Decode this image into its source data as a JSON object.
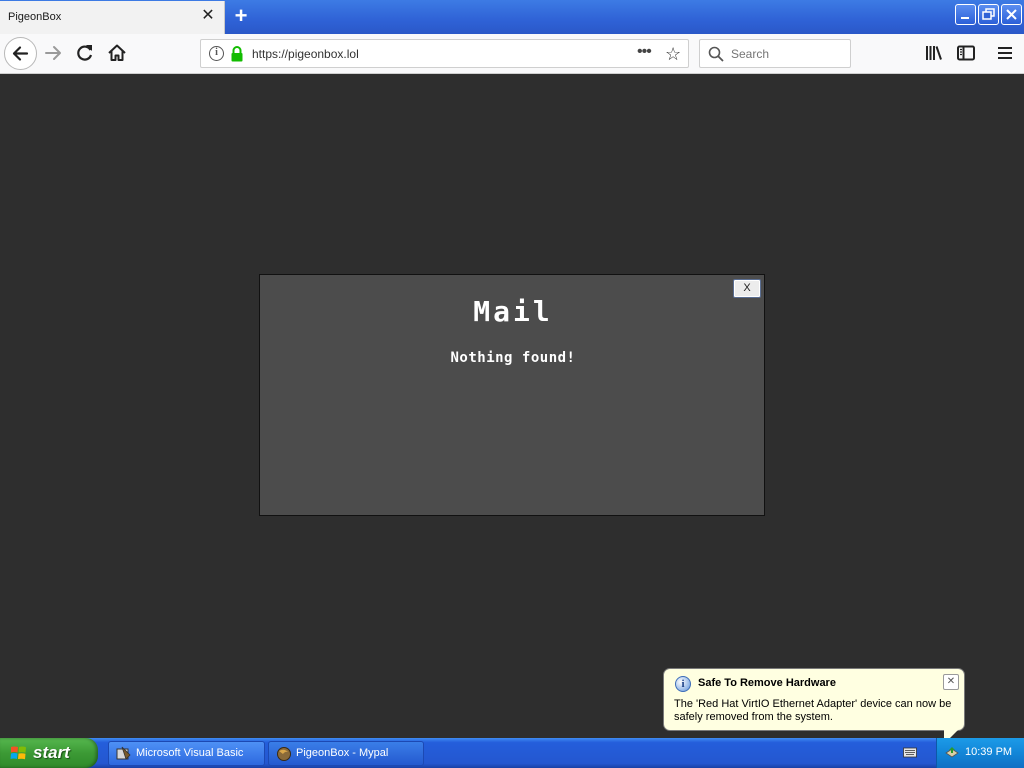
{
  "browser": {
    "tab": {
      "title": "PigeonBox",
      "close_glyph": "✕"
    },
    "new_tab_glyph": "+",
    "window_controls": {
      "minimize": "‗",
      "maximize": "❐",
      "close": "✕"
    },
    "url": "https://pigeonbox.lol",
    "search_placeholder": "Search",
    "icons": [
      "back-arrow-icon",
      "forward-arrow-icon",
      "reload-icon",
      "home-icon",
      "info-icon",
      "lock-icon",
      "page-actions-icon",
      "bookmark-star-icon",
      "search-icon",
      "library-icon",
      "sidebar-icon",
      "hamburger-menu-icon"
    ]
  },
  "modal": {
    "close_label": "X",
    "title": "Mail",
    "message": "Nothing found!"
  },
  "balloon": {
    "title": "Safe To Remove Hardware",
    "text": "The 'Red Hat VirtIO Ethernet Adapter' device can now be safely removed from the system.",
    "close_glyph": "✕"
  },
  "taskbar": {
    "start_label": "start",
    "tasks": [
      {
        "label": "Microsoft Visual Basic"
      },
      {
        "label": "PigeonBox - Mypal"
      }
    ],
    "clock": "10:39 PM"
  },
  "colors": {
    "page_bg": "#2e2e2e",
    "modal_bg": "#4c4c4c",
    "taskbar_blue": "#2457d0",
    "start_green": "#3c9a35",
    "balloon_bg": "#ffffe1",
    "lock_green": "#12bc00"
  }
}
